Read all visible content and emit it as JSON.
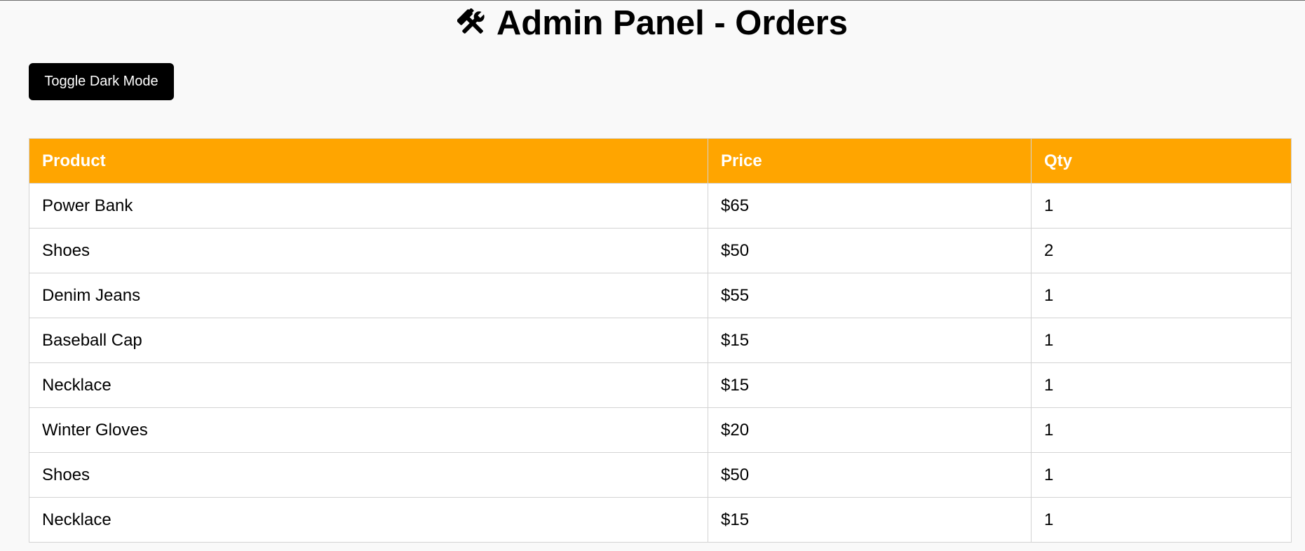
{
  "header": {
    "title": "Admin Panel - Orders",
    "icon": "hammer-and-wrench-icon"
  },
  "toolbar": {
    "toggle_label": "Toggle Dark Mode"
  },
  "colors": {
    "header_bg": "#ffa500",
    "button_bg": "#000000",
    "page_bg": "#f9f9f9"
  },
  "table": {
    "columns": [
      "Product",
      "Price",
      "Qty"
    ],
    "rows": [
      [
        "Power Bank",
        "$65",
        "1"
      ],
      [
        "Shoes",
        "$50",
        "2"
      ],
      [
        "Denim Jeans",
        "$55",
        "1"
      ],
      [
        "Baseball Cap",
        "$15",
        "1"
      ],
      [
        "Necklace",
        "$15",
        "1"
      ],
      [
        "Winter Gloves",
        "$20",
        "1"
      ],
      [
        "Shoes",
        "$50",
        "1"
      ],
      [
        "Necklace",
        "$15",
        "1"
      ]
    ]
  }
}
